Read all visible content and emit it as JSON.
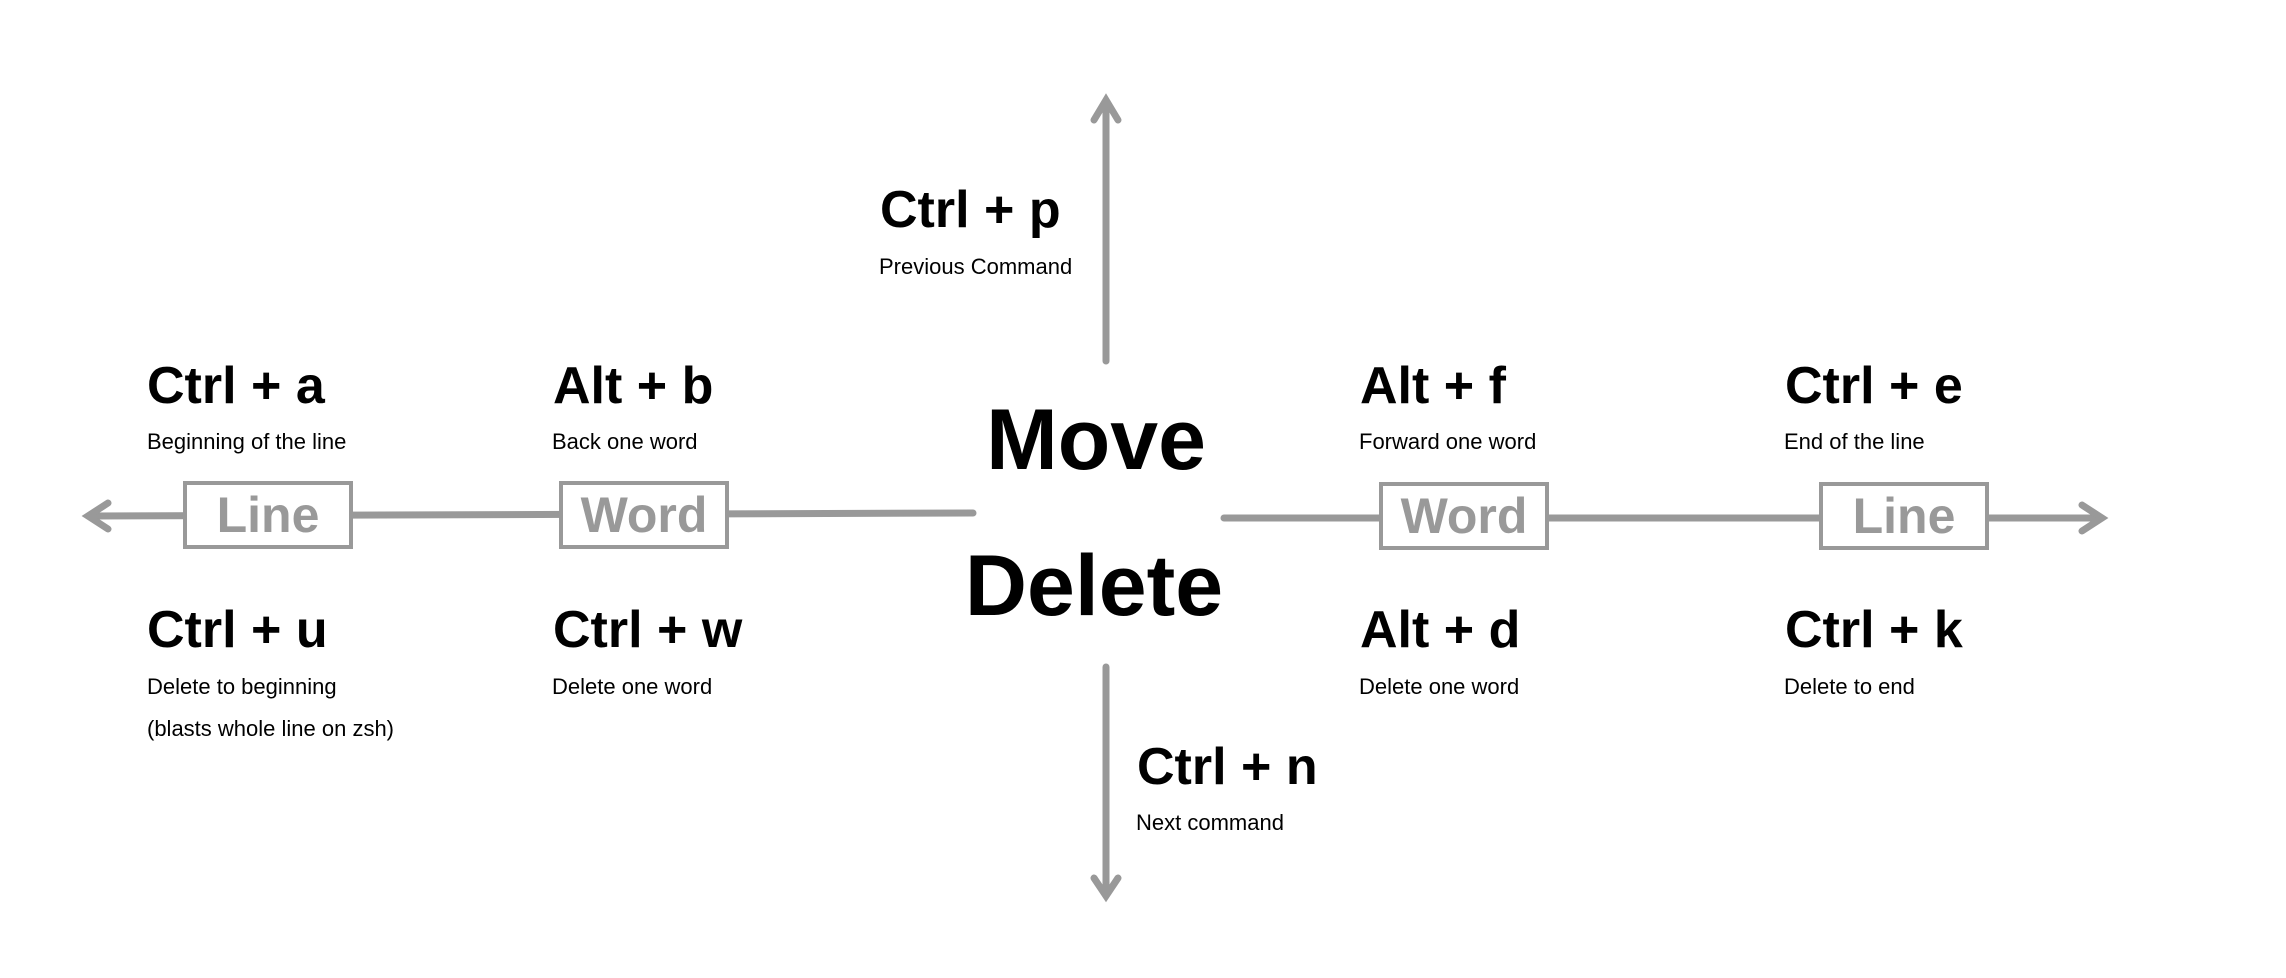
{
  "colors": {
    "line": "#999999",
    "text": "#000000"
  },
  "center": {
    "move": "Move",
    "delete": "Delete"
  },
  "up": {
    "key": "Ctrl + p",
    "desc": "Previous Command"
  },
  "down": {
    "key": "Ctrl + n",
    "desc": "Next command"
  },
  "left": {
    "line_box": "Line",
    "word_box": "Word",
    "move_line": {
      "key": "Ctrl + a",
      "desc": "Beginning of the line"
    },
    "move_word": {
      "key": "Alt + b",
      "desc": "Back one word"
    },
    "delete_line": {
      "key": "Ctrl + u",
      "desc": "Delete to beginning",
      "note": "(blasts whole line on zsh)"
    },
    "delete_word": {
      "key": "Ctrl + w",
      "desc": "Delete one word"
    }
  },
  "right": {
    "word_box": "Word",
    "line_box": "Line",
    "move_word": {
      "key": "Alt + f",
      "desc": "Forward one word"
    },
    "move_line": {
      "key": "Ctrl + e",
      "desc": "End of the line"
    },
    "delete_word": {
      "key": "Alt + d",
      "desc": "Delete one word"
    },
    "delete_line": {
      "key": "Ctrl + k",
      "desc": "Delete to end"
    }
  }
}
